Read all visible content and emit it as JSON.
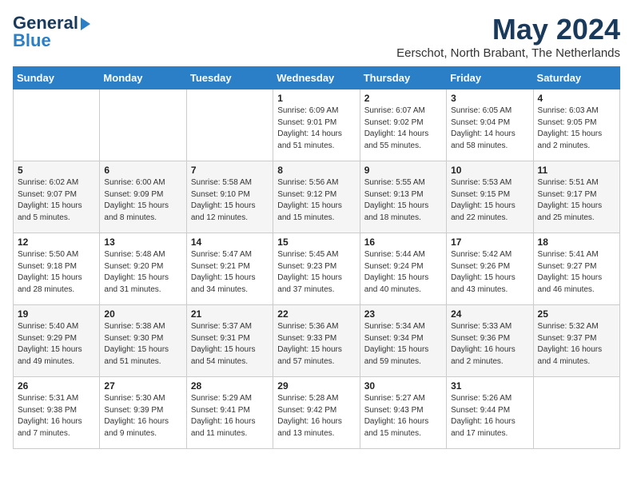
{
  "logo": {
    "general": "General",
    "blue": "Blue"
  },
  "header": {
    "month_year": "May 2024",
    "location": "Eerschot, North Brabant, The Netherlands"
  },
  "weekdays": [
    "Sunday",
    "Monday",
    "Tuesday",
    "Wednesday",
    "Thursday",
    "Friday",
    "Saturday"
  ],
  "weeks": [
    [
      {
        "day": "",
        "content": ""
      },
      {
        "day": "",
        "content": ""
      },
      {
        "day": "",
        "content": ""
      },
      {
        "day": "1",
        "content": "Sunrise: 6:09 AM\nSunset: 9:01 PM\nDaylight: 14 hours\nand 51 minutes."
      },
      {
        "day": "2",
        "content": "Sunrise: 6:07 AM\nSunset: 9:02 PM\nDaylight: 14 hours\nand 55 minutes."
      },
      {
        "day": "3",
        "content": "Sunrise: 6:05 AM\nSunset: 9:04 PM\nDaylight: 14 hours\nand 58 minutes."
      },
      {
        "day": "4",
        "content": "Sunrise: 6:03 AM\nSunset: 9:05 PM\nDaylight: 15 hours\nand 2 minutes."
      }
    ],
    [
      {
        "day": "5",
        "content": "Sunrise: 6:02 AM\nSunset: 9:07 PM\nDaylight: 15 hours\nand 5 minutes."
      },
      {
        "day": "6",
        "content": "Sunrise: 6:00 AM\nSunset: 9:09 PM\nDaylight: 15 hours\nand 8 minutes."
      },
      {
        "day": "7",
        "content": "Sunrise: 5:58 AM\nSunset: 9:10 PM\nDaylight: 15 hours\nand 12 minutes."
      },
      {
        "day": "8",
        "content": "Sunrise: 5:56 AM\nSunset: 9:12 PM\nDaylight: 15 hours\nand 15 minutes."
      },
      {
        "day": "9",
        "content": "Sunrise: 5:55 AM\nSunset: 9:13 PM\nDaylight: 15 hours\nand 18 minutes."
      },
      {
        "day": "10",
        "content": "Sunrise: 5:53 AM\nSunset: 9:15 PM\nDaylight: 15 hours\nand 22 minutes."
      },
      {
        "day": "11",
        "content": "Sunrise: 5:51 AM\nSunset: 9:17 PM\nDaylight: 15 hours\nand 25 minutes."
      }
    ],
    [
      {
        "day": "12",
        "content": "Sunrise: 5:50 AM\nSunset: 9:18 PM\nDaylight: 15 hours\nand 28 minutes."
      },
      {
        "day": "13",
        "content": "Sunrise: 5:48 AM\nSunset: 9:20 PM\nDaylight: 15 hours\nand 31 minutes."
      },
      {
        "day": "14",
        "content": "Sunrise: 5:47 AM\nSunset: 9:21 PM\nDaylight: 15 hours\nand 34 minutes."
      },
      {
        "day": "15",
        "content": "Sunrise: 5:45 AM\nSunset: 9:23 PM\nDaylight: 15 hours\nand 37 minutes."
      },
      {
        "day": "16",
        "content": "Sunrise: 5:44 AM\nSunset: 9:24 PM\nDaylight: 15 hours\nand 40 minutes."
      },
      {
        "day": "17",
        "content": "Sunrise: 5:42 AM\nSunset: 9:26 PM\nDaylight: 15 hours\nand 43 minutes."
      },
      {
        "day": "18",
        "content": "Sunrise: 5:41 AM\nSunset: 9:27 PM\nDaylight: 15 hours\nand 46 minutes."
      }
    ],
    [
      {
        "day": "19",
        "content": "Sunrise: 5:40 AM\nSunset: 9:29 PM\nDaylight: 15 hours\nand 49 minutes."
      },
      {
        "day": "20",
        "content": "Sunrise: 5:38 AM\nSunset: 9:30 PM\nDaylight: 15 hours\nand 51 minutes."
      },
      {
        "day": "21",
        "content": "Sunrise: 5:37 AM\nSunset: 9:31 PM\nDaylight: 15 hours\nand 54 minutes."
      },
      {
        "day": "22",
        "content": "Sunrise: 5:36 AM\nSunset: 9:33 PM\nDaylight: 15 hours\nand 57 minutes."
      },
      {
        "day": "23",
        "content": "Sunrise: 5:34 AM\nSunset: 9:34 PM\nDaylight: 15 hours\nand 59 minutes."
      },
      {
        "day": "24",
        "content": "Sunrise: 5:33 AM\nSunset: 9:36 PM\nDaylight: 16 hours\nand 2 minutes."
      },
      {
        "day": "25",
        "content": "Sunrise: 5:32 AM\nSunset: 9:37 PM\nDaylight: 16 hours\nand 4 minutes."
      }
    ],
    [
      {
        "day": "26",
        "content": "Sunrise: 5:31 AM\nSunset: 9:38 PM\nDaylight: 16 hours\nand 7 minutes."
      },
      {
        "day": "27",
        "content": "Sunrise: 5:30 AM\nSunset: 9:39 PM\nDaylight: 16 hours\nand 9 minutes."
      },
      {
        "day": "28",
        "content": "Sunrise: 5:29 AM\nSunset: 9:41 PM\nDaylight: 16 hours\nand 11 minutes."
      },
      {
        "day": "29",
        "content": "Sunrise: 5:28 AM\nSunset: 9:42 PM\nDaylight: 16 hours\nand 13 minutes."
      },
      {
        "day": "30",
        "content": "Sunrise: 5:27 AM\nSunset: 9:43 PM\nDaylight: 16 hours\nand 15 minutes."
      },
      {
        "day": "31",
        "content": "Sunrise: 5:26 AM\nSunset: 9:44 PM\nDaylight: 16 hours\nand 17 minutes."
      },
      {
        "day": "",
        "content": ""
      }
    ]
  ]
}
